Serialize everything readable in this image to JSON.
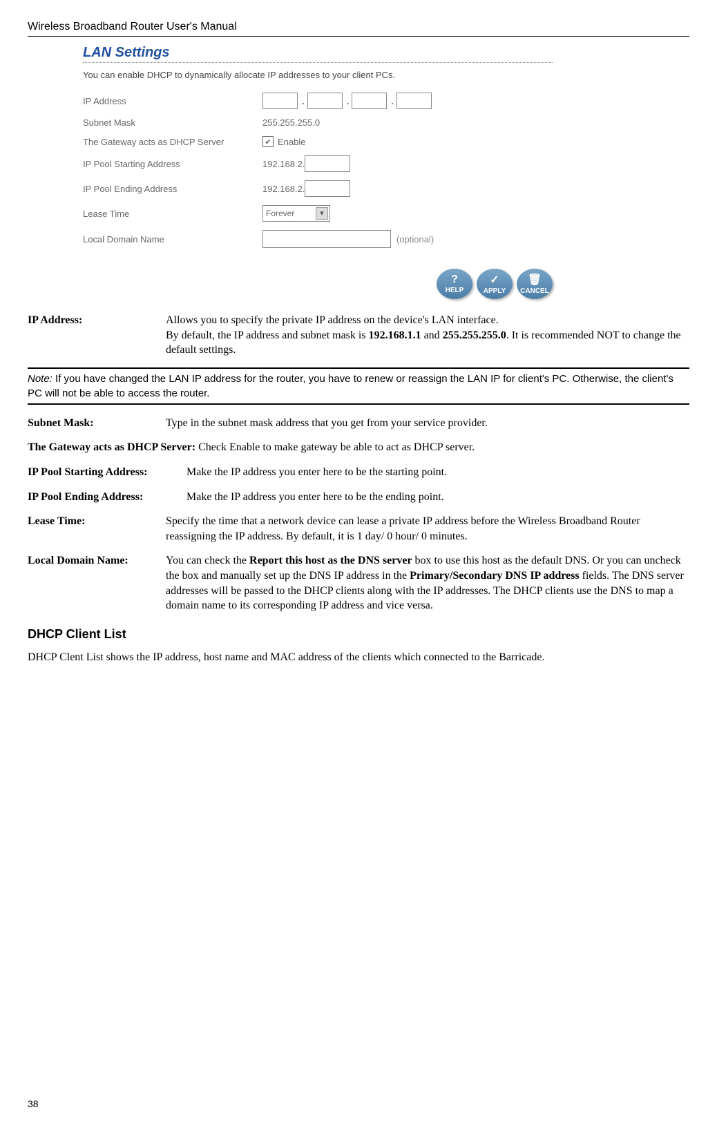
{
  "header": "Wireless Broadband Router User's Manual",
  "screenshot": {
    "title": "LAN Settings",
    "description": "You can enable DHCP to dynamically allocate IP addresses to your client PCs.",
    "rows": {
      "ip_address_label": "IP Address",
      "subnet_mask_label": "Subnet Mask",
      "subnet_mask_value": "255.255.255.0",
      "gateway_label": "The Gateway acts as DHCP Server",
      "enable_label": "Enable",
      "pool_start_label": "IP Pool Starting Address",
      "pool_start_prefix": "192.168.2.",
      "pool_end_label": "IP Pool Ending Address",
      "pool_end_prefix": "192.168.2.",
      "lease_label": "Lease Time",
      "lease_value": "Forever",
      "domain_label": "Local Domain Name",
      "optional": "(optional)"
    },
    "buttons": {
      "help": "HELP",
      "apply": "APPLY",
      "cancel": "CANCEL"
    }
  },
  "fields": {
    "ip_address": {
      "label": "IP Address:",
      "desc_1": "Allows you to specify the private IP address on the device's LAN interface.",
      "desc_2a": "By default, the IP address and subnet mask is ",
      "desc_2b": "192.168.1.1",
      "desc_2c": " and ",
      "desc_2d": "255.255.255.0",
      "desc_2e": ". It is recommended NOT to change the default settings."
    },
    "note_prefix": "Note:",
    "note_text": " If you have changed the LAN IP address for the router, you have to renew or reassign the LAN IP for client's PC. Otherwise, the client's PC will not be able to access the router.",
    "subnet_mask": {
      "label": "Subnet Mask:",
      "desc": "Type in the subnet mask address that you get from your service provider."
    },
    "gateway_dhcp": {
      "label": "The Gateway acts as DHCP Server:",
      "desc": " Check Enable to make gateway be able to act as DHCP server."
    },
    "pool_start": {
      "label": "IP Pool Starting Address:",
      "desc": "Make the IP address you enter here to be the starting point."
    },
    "pool_end": {
      "label": "IP Pool Ending Address:",
      "desc": "Make the IP address you enter here to be the ending point."
    },
    "lease_time": {
      "label": "Lease Time:",
      "desc": "Specify the time that a network device can lease a private IP address before the Wireless Broadband Router reassigning the IP address. By default, it is 1 day/ 0 hour/ 0 minutes."
    },
    "local_domain": {
      "label": "Local Domain Name:",
      "desc_a": "You can check the ",
      "desc_b": "Report this host as the DNS server",
      "desc_c": " box to use this host as the default DNS. Or you can uncheck the box and manually set up the DNS IP address in the ",
      "desc_d": "Primary/Secondary DNS IP address",
      "desc_e": " fields. The DNS server addresses will be passed to the DHCP clients along with the IP addresses. The DHCP clients use the DNS to map a domain name to its corresponding IP address and vice versa."
    }
  },
  "dhcp_section": {
    "heading": "DHCP Client List",
    "body": "DHCP Clent List shows the IP address, host name and MAC address of the clients which connected to the Barricade."
  },
  "page_number": "38"
}
